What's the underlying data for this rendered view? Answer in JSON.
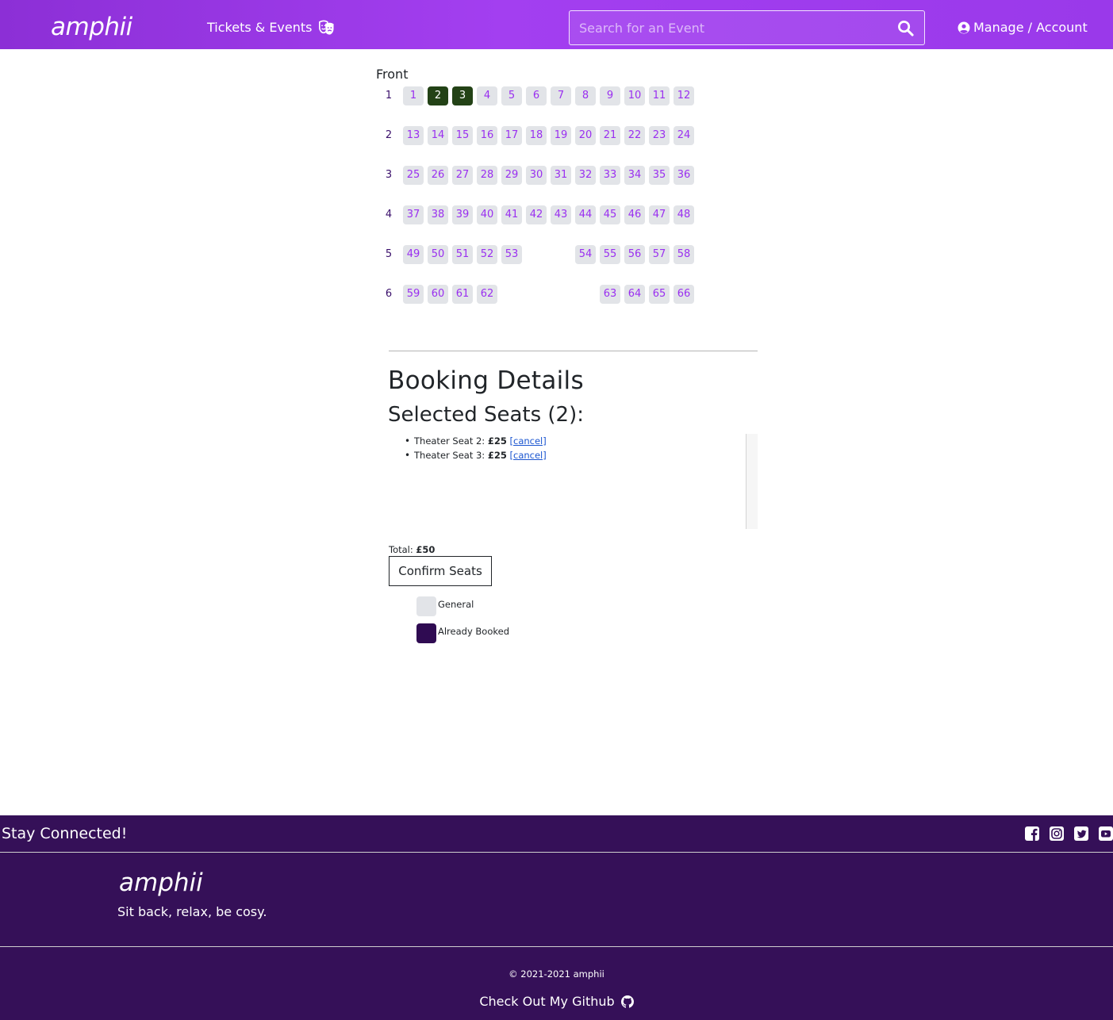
{
  "navbar": {
    "brand": "amphii",
    "tickets_label": "Tickets & Events",
    "tickets_icon": "theater-masks-icon",
    "search_placeholder": "Search for an Event",
    "search_icon": "search-icon",
    "account_label": "Manage / Account",
    "account_icon": "user-circle-icon"
  },
  "seat_map": {
    "front_label": "Front",
    "rows": [
      {
        "label": "1",
        "seats": [
          {
            "n": "1",
            "col": 0
          },
          {
            "n": "2",
            "col": 1,
            "selected": true
          },
          {
            "n": "3",
            "col": 2,
            "selected": true
          },
          {
            "n": "4",
            "col": 3
          },
          {
            "n": "5",
            "col": 4
          },
          {
            "n": "6",
            "col": 5
          },
          {
            "n": "7",
            "col": 6
          },
          {
            "n": "8",
            "col": 7
          },
          {
            "n": "9",
            "col": 8
          },
          {
            "n": "10",
            "col": 9
          },
          {
            "n": "11",
            "col": 10
          },
          {
            "n": "12",
            "col": 11
          }
        ]
      },
      {
        "label": "2",
        "seats": [
          {
            "n": "13",
            "col": 0
          },
          {
            "n": "14",
            "col": 1
          },
          {
            "n": "15",
            "col": 2
          },
          {
            "n": "16",
            "col": 3
          },
          {
            "n": "17",
            "col": 4
          },
          {
            "n": "18",
            "col": 5
          },
          {
            "n": "19",
            "col": 6
          },
          {
            "n": "20",
            "col": 7
          },
          {
            "n": "21",
            "col": 8
          },
          {
            "n": "22",
            "col": 9
          },
          {
            "n": "23",
            "col": 10
          },
          {
            "n": "24",
            "col": 11
          }
        ]
      },
      {
        "label": "3",
        "seats": [
          {
            "n": "25",
            "col": 0
          },
          {
            "n": "26",
            "col": 1
          },
          {
            "n": "27",
            "col": 2
          },
          {
            "n": "28",
            "col": 3
          },
          {
            "n": "29",
            "col": 4
          },
          {
            "n": "30",
            "col": 5
          },
          {
            "n": "31",
            "col": 6
          },
          {
            "n": "32",
            "col": 7
          },
          {
            "n": "33",
            "col": 8
          },
          {
            "n": "34",
            "col": 9
          },
          {
            "n": "35",
            "col": 10
          },
          {
            "n": "36",
            "col": 11
          }
        ]
      },
      {
        "label": "4",
        "seats": [
          {
            "n": "37",
            "col": 0
          },
          {
            "n": "38",
            "col": 1
          },
          {
            "n": "39",
            "col": 2
          },
          {
            "n": "40",
            "col": 3
          },
          {
            "n": "41",
            "col": 4
          },
          {
            "n": "42",
            "col": 5
          },
          {
            "n": "43",
            "col": 6
          },
          {
            "n": "44",
            "col": 7
          },
          {
            "n": "45",
            "col": 8
          },
          {
            "n": "46",
            "col": 9
          },
          {
            "n": "47",
            "col": 10
          },
          {
            "n": "48",
            "col": 11
          }
        ]
      },
      {
        "label": "5",
        "seats": [
          {
            "n": "49",
            "col": 0
          },
          {
            "n": "50",
            "col": 1
          },
          {
            "n": "51",
            "col": 2
          },
          {
            "n": "52",
            "col": 3
          },
          {
            "n": "53",
            "col": 4
          },
          {
            "n": "54",
            "col": 7
          },
          {
            "n": "55",
            "col": 8
          },
          {
            "n": "56",
            "col": 9
          },
          {
            "n": "57",
            "col": 10
          },
          {
            "n": "58",
            "col": 11
          }
        ]
      },
      {
        "label": "6",
        "seats": [
          {
            "n": "59",
            "col": 0
          },
          {
            "n": "60",
            "col": 1
          },
          {
            "n": "61",
            "col": 2
          },
          {
            "n": "62",
            "col": 3
          },
          {
            "n": "63",
            "col": 8
          },
          {
            "n": "64",
            "col": 9
          },
          {
            "n": "65",
            "col": 10
          },
          {
            "n": "66",
            "col": 11
          }
        ]
      }
    ]
  },
  "booking": {
    "heading": "Booking Details",
    "selected_heading": "Selected Seats (2):",
    "items": [
      {
        "label": "Theater Seat 2:",
        "price": "£25",
        "cancel": "[cancel]"
      },
      {
        "label": "Theater Seat 3:",
        "price": "£25",
        "cancel": "[cancel]"
      }
    ],
    "total_label": "Total:",
    "total_value": "£50",
    "confirm_label": "Confirm Seats"
  },
  "legend": [
    {
      "label": "General",
      "color": "#e2e4e8"
    },
    {
      "label": "Already Booked",
      "color": "#2f0b52"
    }
  ],
  "colors": {
    "nav_gradient_start": "#8c2fd6",
    "nav_gradient_end": "#a33ff0",
    "footer_bg": "#351058",
    "seat_bg": "#e2e4e8",
    "seat_text": "#9a2ff0",
    "seat_selected": "#234216"
  },
  "footer": {
    "stay_connected": "Stay Connected!",
    "social_icons": [
      "facebook-icon",
      "instagram-icon",
      "twitter-icon",
      "youtube-icon"
    ],
    "brand": "amphii",
    "tagline": "Sit back, relax, be cosy.",
    "copyright": "© 2021-2021 amphii",
    "github_label": "Check Out My Github",
    "github_icon": "github-icon"
  }
}
